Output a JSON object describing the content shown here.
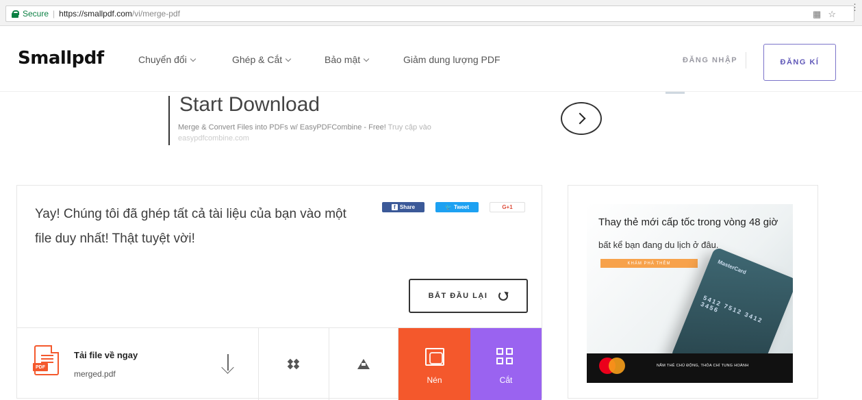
{
  "browser": {
    "secure_label": "Secure",
    "url_domain": "https://smallpdf.com",
    "url_path": "/vi/merge-pdf",
    "icons": [
      "translate-icon",
      "star-icon",
      "menu-icon"
    ]
  },
  "header": {
    "logo": "Smallpdf",
    "nav": [
      {
        "label": "Chuyển đổi",
        "has_dropdown": true
      },
      {
        "label": "Ghép & Cắt",
        "has_dropdown": true
      },
      {
        "label": "Bảo mật",
        "has_dropdown": true
      },
      {
        "label": "Giảm dung lượng PDF",
        "has_dropdown": false
      }
    ],
    "login_label": "ĐĂNG NHẬP",
    "signup_label": "ĐĂNG KÍ",
    "colors": {
      "signup_border": "#7b73c9"
    }
  },
  "ad": {
    "title": "Start Download",
    "description": "Merge & Convert Files into PDFs w/ EasyPDFCombine - Free!",
    "visit_text": "Truy cập vào",
    "display_url": "easypdfcombine.com"
  },
  "result": {
    "message": "Yay! Chúng tôi đã ghép tất cả tài liệu của bạn vào một file duy nhất! Thật tuyệt vời!",
    "share_label": "Share",
    "tweet_label": "Tweet",
    "gplus_label": "G+1",
    "restart_label": "BẮT ĐẦU LẠI",
    "download_title": "Tải file về ngay",
    "file_name": "merged.pdf",
    "pdf_tag": "PDF",
    "compress_label": "Nén",
    "split_label": "Cắt",
    "colors": {
      "compress": "#f4582c",
      "split": "#9a63f0",
      "facebook": "#3b5998",
      "twitter": "#1da1f2"
    }
  },
  "side_ad": {
    "headline": "Thay thẻ mới cấp tốc trong vòng 48 giờ",
    "subline": "bất kể bạn đang du lịch ở đâu.",
    "button": "KHÁM PHÁ THÊM",
    "card_brand": "MasterCard",
    "card_numbers": "5412 7512 3412 3456",
    "footer_text": "NẮM THẺ CHỦ ĐỘNG, THỎA CHÍ TUNG HOÀNH"
  }
}
